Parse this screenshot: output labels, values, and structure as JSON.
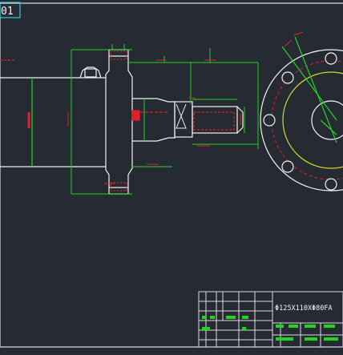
{
  "drawing": {
    "tab_label": "01",
    "part_spec": "Φ125X110XΦ80FA"
  },
  "colors": {
    "background": "#252a33",
    "frame": "#d9d9d9",
    "green": "#22d422",
    "red": "#e0202a",
    "white": "#f2f2f2",
    "yellow": "#d8d81e",
    "cyan": "#3fc7d9"
  }
}
